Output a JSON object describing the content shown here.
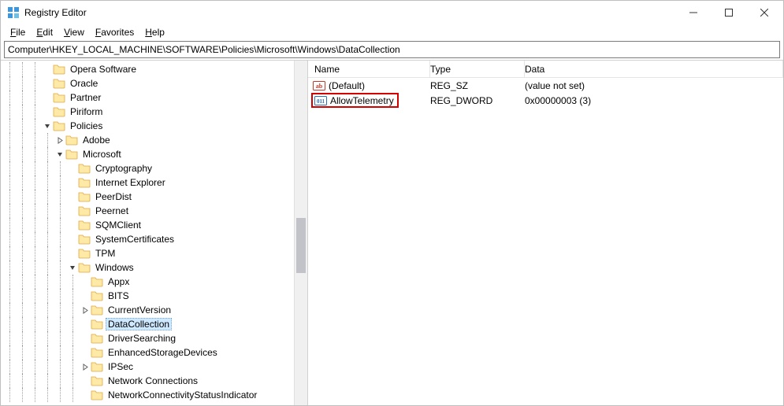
{
  "window": {
    "title": "Registry Editor"
  },
  "menu": {
    "file": "File",
    "edit": "Edit",
    "view": "View",
    "favorites": "Favorites",
    "help": "Help"
  },
  "address": "Computer\\HKEY_LOCAL_MACHINE\\SOFTWARE\\Policies\\Microsoft\\Windows\\DataCollection",
  "list": {
    "headers": {
      "name": "Name",
      "type": "Type",
      "data": "Data"
    },
    "rows": [
      {
        "icon": "ab",
        "name": "(Default)",
        "type": "REG_SZ",
        "data": "(value not set)",
        "highlight": false
      },
      {
        "icon": "num",
        "name": "AllowTelemetry",
        "type": "REG_DWORD",
        "data": "0x00000003 (3)",
        "highlight": true
      }
    ]
  },
  "tree": [
    {
      "indent": 3,
      "expander": "none",
      "label": "Opera Software"
    },
    {
      "indent": 3,
      "expander": "none",
      "label": "Oracle"
    },
    {
      "indent": 3,
      "expander": "none",
      "label": "Partner"
    },
    {
      "indent": 3,
      "expander": "none",
      "label": "Piriform"
    },
    {
      "indent": 3,
      "expander": "open",
      "label": "Policies"
    },
    {
      "indent": 4,
      "expander": "closed",
      "label": "Adobe"
    },
    {
      "indent": 4,
      "expander": "open",
      "label": "Microsoft"
    },
    {
      "indent": 5,
      "expander": "none",
      "label": "Cryptography"
    },
    {
      "indent": 5,
      "expander": "none",
      "label": "Internet Explorer"
    },
    {
      "indent": 5,
      "expander": "none",
      "label": "PeerDist"
    },
    {
      "indent": 5,
      "expander": "none",
      "label": "Peernet"
    },
    {
      "indent": 5,
      "expander": "none",
      "label": "SQMClient"
    },
    {
      "indent": 5,
      "expander": "none",
      "label": "SystemCertificates"
    },
    {
      "indent": 5,
      "expander": "none",
      "label": "TPM"
    },
    {
      "indent": 5,
      "expander": "open",
      "label": "Windows"
    },
    {
      "indent": 6,
      "expander": "none",
      "label": "Appx"
    },
    {
      "indent": 6,
      "expander": "none",
      "label": "BITS"
    },
    {
      "indent": 6,
      "expander": "closed",
      "label": "CurrentVersion"
    },
    {
      "indent": 6,
      "expander": "none",
      "label": "DataCollection",
      "selected": true
    },
    {
      "indent": 6,
      "expander": "none",
      "label": "DriverSearching"
    },
    {
      "indent": 6,
      "expander": "none",
      "label": "EnhancedStorageDevices"
    },
    {
      "indent": 6,
      "expander": "closed",
      "label": "IPSec"
    },
    {
      "indent": 6,
      "expander": "none",
      "label": "Network Connections"
    },
    {
      "indent": 6,
      "expander": "none",
      "label": "NetworkConnectivityStatusIndicator"
    }
  ]
}
